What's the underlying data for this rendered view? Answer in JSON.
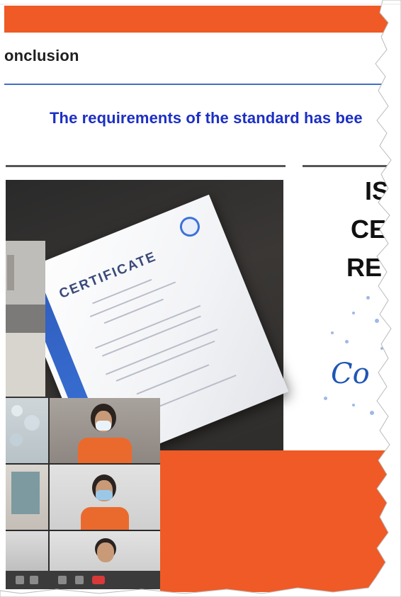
{
  "slide": {
    "heading": "onclusion",
    "statement": "The requirements of the standard has bee",
    "accent_color": "#ef5a26",
    "rule_color": "#3e6fcb",
    "statement_color": "#1c2fc4"
  },
  "certificate": {
    "title": "CERTIFICATE"
  },
  "right_panel": {
    "line1": "IS",
    "line2": "CE",
    "line3": "RE",
    "script_text": "Co"
  }
}
